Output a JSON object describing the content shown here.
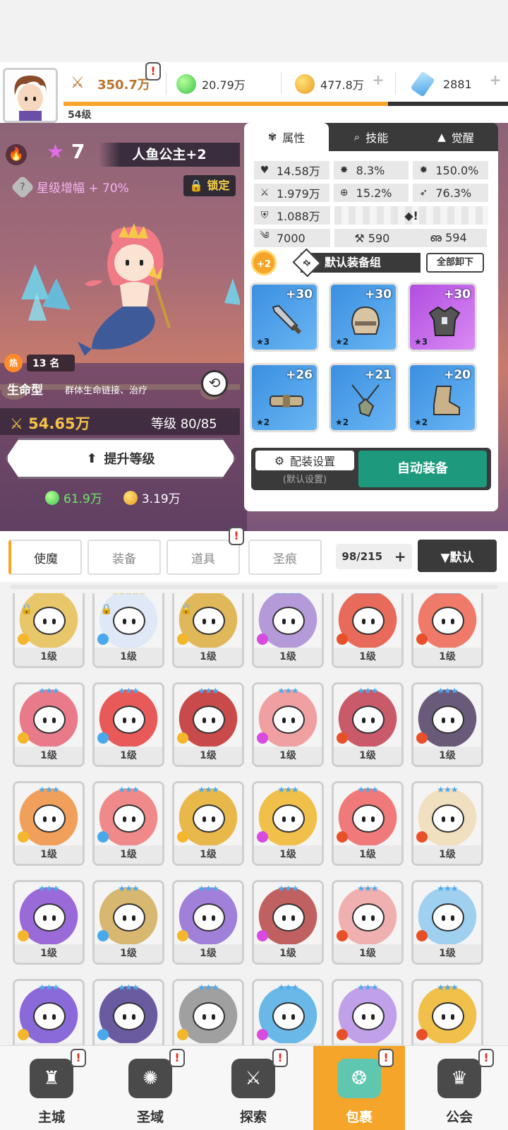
{
  "topbar": {
    "power": "350.7万",
    "gem": "20.79万",
    "gold": "477.8万",
    "crystal": "2881",
    "player_level": "54级",
    "xp_fraction": 0.73
  },
  "hero": {
    "stars": "7",
    "name": "人鱼公主+2",
    "star_boost": "星级增幅 + 70%",
    "lock": "锁定",
    "hot_label": "热",
    "rank": "13 名",
    "type": "生命型",
    "type_desc": "群体生命链接、治疗",
    "power": "54.65万",
    "level": "等级 80/85",
    "levelup": "提升等级",
    "cost_gem": "61.9万",
    "cost_gold": "3.19万"
  },
  "stats": {
    "tabs": [
      "属性",
      "技能",
      "觉醒"
    ],
    "hp": "14.58万",
    "crit": "8.3%",
    "crit_dmg": "150.0%",
    "atk": "1.979万",
    "hit": "15.2%",
    "dodge": "76.3%",
    "def": "1.088万",
    "spd": "7000",
    "res1": "590",
    "res2": "594"
  },
  "equipment": {
    "badge": "+2",
    "set_name": "默认装备组",
    "unequip_all": "全部卸下",
    "items": [
      {
        "plus": "+30",
        "stars": "★3"
      },
      {
        "plus": "+30",
        "stars": "★2"
      },
      {
        "plus": "+30",
        "stars": "★3"
      },
      {
        "plus": "+26",
        "stars": "★2"
      },
      {
        "plus": "+21",
        "stars": "★2"
      },
      {
        "plus": "+20",
        "stars": "★2"
      }
    ],
    "settings": "配装设置",
    "settings_sub": "(默认设置)",
    "auto": "自动装备"
  },
  "filters": {
    "tabs": [
      "使魔",
      "装备",
      "道具",
      "圣痕"
    ],
    "count": "98/215",
    "count_plus": "+",
    "sort": "▼默认"
  },
  "grid": {
    "level_label": "1级"
  },
  "nav": [
    "主城",
    "圣域",
    "探索",
    "包裹",
    "公会"
  ],
  "colors": {
    "accent": "#f4a52a",
    "auto_button": "#1d9a7d",
    "dark": "#3a3a3a"
  }
}
